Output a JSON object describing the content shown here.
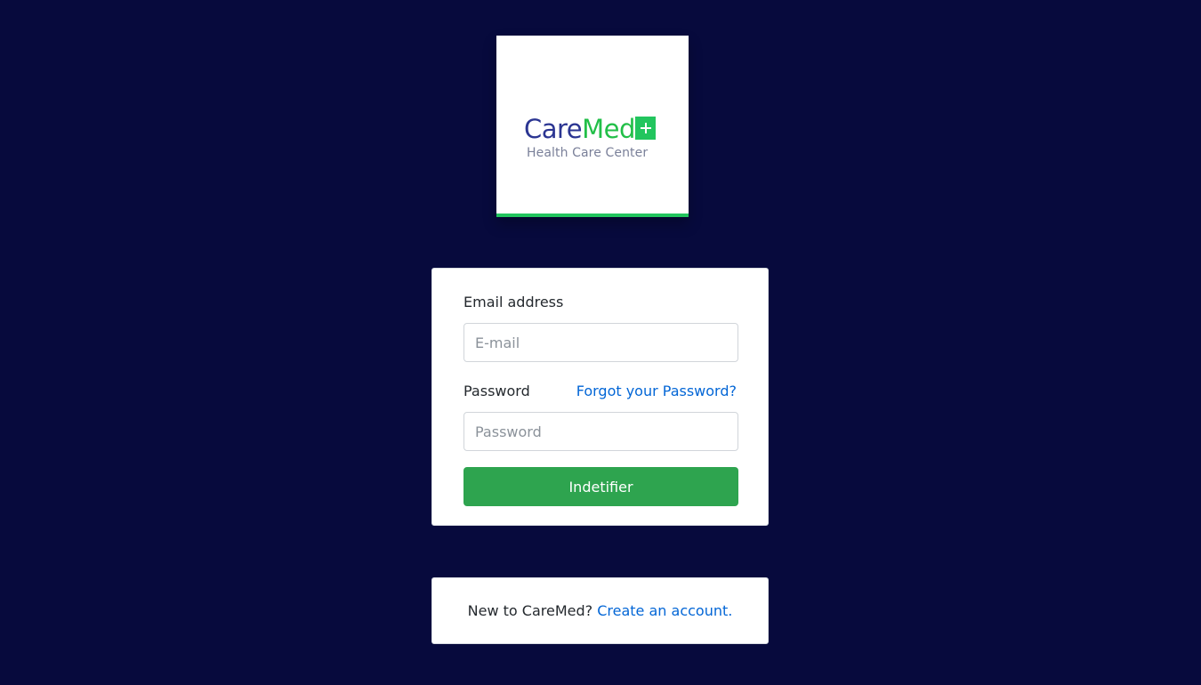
{
  "logo": {
    "wordmark_part1": "Care",
    "wordmark_part2": "Med",
    "icon": "plus-icon",
    "tagline": "Health Care Center"
  },
  "login": {
    "email_label": "Email address",
    "email_placeholder": "E-mail",
    "email_value": "",
    "password_label": "Password",
    "forgot_link": "Forgot your Password?",
    "password_placeholder": "Password",
    "password_value": "",
    "submit_label": "Indetifier"
  },
  "signup": {
    "prompt": "New to CareMed?",
    "link": "Create an account."
  },
  "colors": {
    "page_background": "#070a3d",
    "brand_blue": "#2b3592",
    "brand_green": "#22c55e",
    "button_green": "#2ea44f",
    "link_blue": "#0366d6"
  }
}
